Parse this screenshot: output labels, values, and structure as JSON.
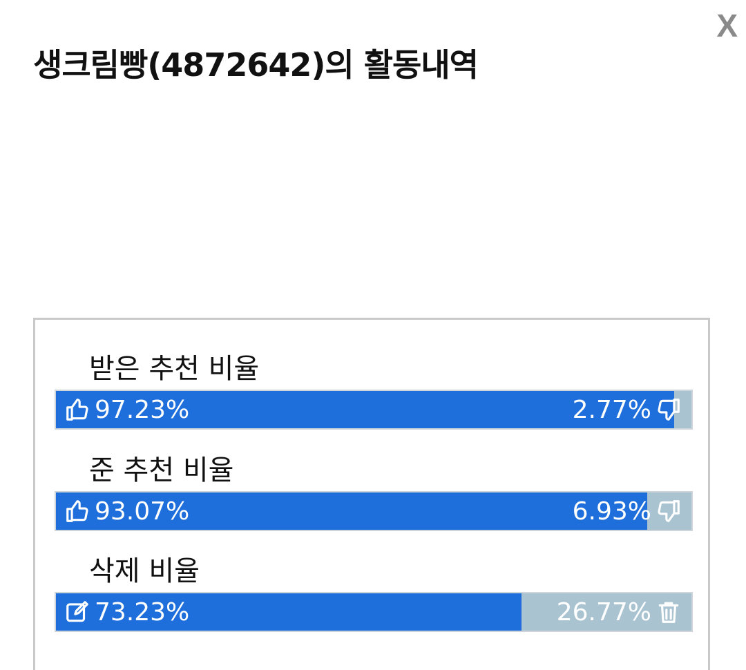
{
  "window": {
    "title": "생크림빵(4872642)의 활동내역",
    "close_label": "X"
  },
  "stats": [
    {
      "label": "받은 추천 비율",
      "left_value": "97.23%",
      "right_value": "2.77%",
      "ratio": 0.9723,
      "left_icon": "thumbs-up-icon",
      "right_icon": "thumbs-down-icon"
    },
    {
      "label": "준 추천 비율",
      "left_value": "93.07%",
      "right_value": "6.93%",
      "ratio": 0.9307,
      "left_icon": "thumbs-up-icon",
      "right_icon": "thumbs-down-icon"
    },
    {
      "label": "삭제 비율",
      "left_value": "73.23%",
      "right_value": "26.77%",
      "ratio": 0.7323,
      "left_icon": "edit-icon",
      "right_icon": "trash-icon"
    }
  ],
  "colors": {
    "primary_fill": "#1e6fdc",
    "secondary_fill": "#a9c3d1"
  }
}
